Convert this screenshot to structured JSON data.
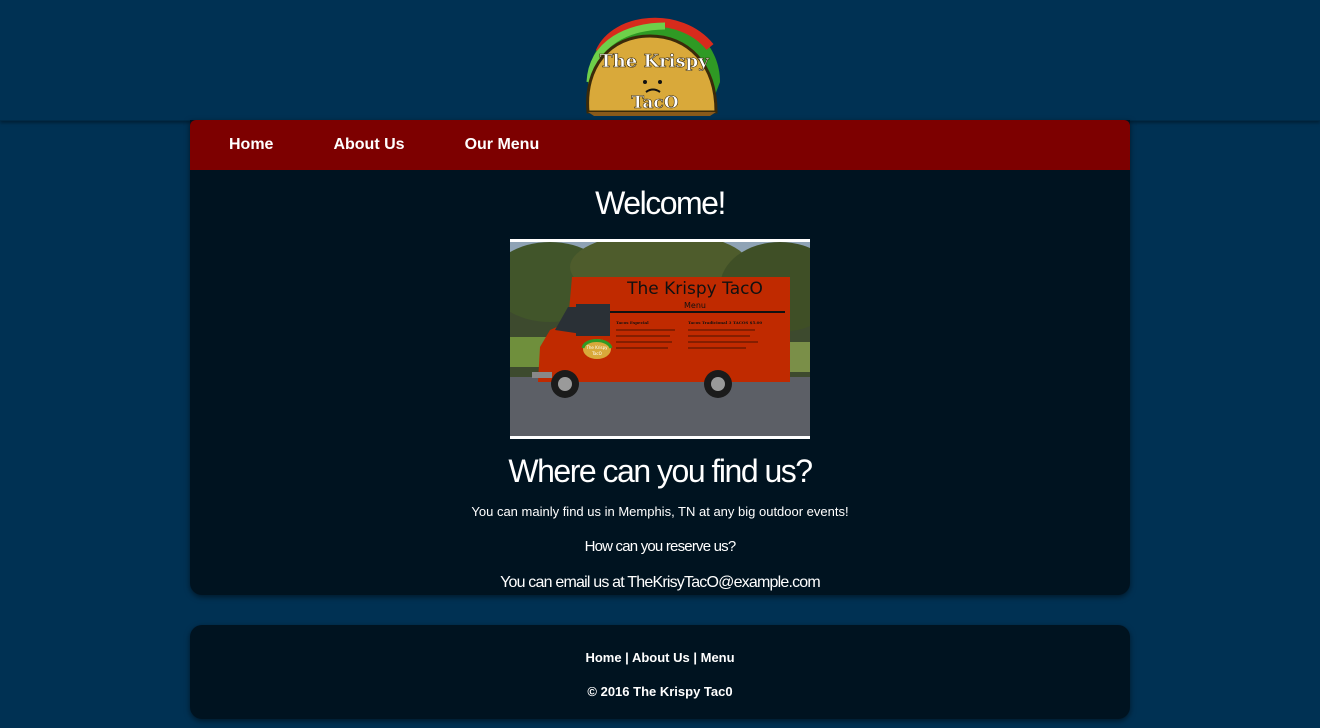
{
  "brand": {
    "logo_line1": "The Krispy",
    "logo_line2": "TacO"
  },
  "nav": {
    "items": [
      {
        "label": "Home"
      },
      {
        "label": "About Us"
      },
      {
        "label": "Our Menu"
      }
    ]
  },
  "main": {
    "welcome_heading": "Welcome!",
    "truck_image": {
      "title": "The Krispy TacO",
      "subtitle": "Menu",
      "menu_left_heading": "Tacos Especial",
      "menu_right_heading": "Tacos Tradicional 3 TACOS $5.00",
      "logo_line1": "The Krispy",
      "logo_line2": "TacO"
    },
    "find_heading": "Where can you find us?",
    "find_text": "You can mainly find us in Memphis, TN at any big outdoor events!",
    "reserve_question": "How can you reserve us?",
    "reserve_text": "You can email us at TheKrisyTacO@example.com"
  },
  "footer": {
    "link_home": "Home",
    "link_about": "About Us",
    "link_menu": "Menu",
    "separator": " | ",
    "copyright": "© 2016 The Krispy Tac0"
  },
  "colors": {
    "page_bg": "#003153",
    "panel_bg": "#001320",
    "nav_bg": "#7d0000",
    "truck_red": "#c02a00",
    "taco_yellow": "#d9a93a"
  }
}
